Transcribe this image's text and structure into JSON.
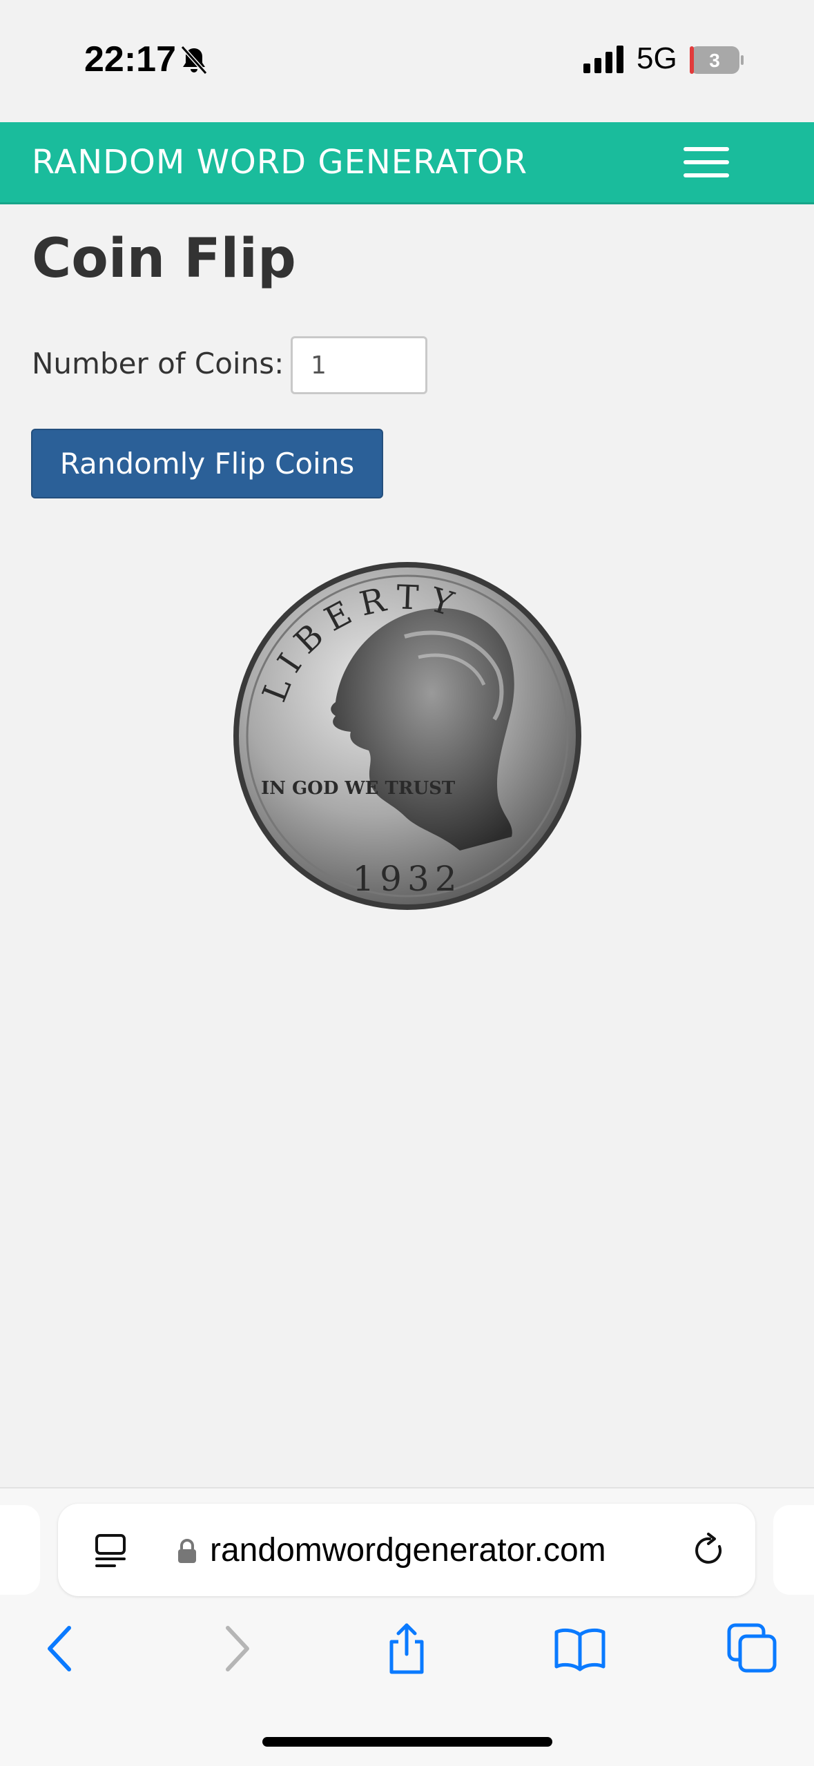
{
  "status_bar": {
    "time": "22:17",
    "network": "5G",
    "battery": "3"
  },
  "header": {
    "brand": "RANDOM WORD GENERATOR",
    "menu_icon": "hamburger-menu-icon"
  },
  "main": {
    "title": "Coin Flip",
    "coins_label": "Number of Coins:",
    "coins_value": "1",
    "flip_button": "Randomly Flip Coins",
    "coin_image": {
      "icon": "quarter-coin-heads",
      "text_top": "LIBERTY",
      "text_left": "IN GOD WE TRUST",
      "text_bottom": "1932"
    }
  },
  "browser": {
    "url": "randomwordgenerator.com",
    "icons": [
      "reader-icon",
      "lock-icon",
      "reload-icon",
      "back-icon",
      "forward-icon",
      "share-icon",
      "bookmarks-icon",
      "tabs-icon"
    ]
  },
  "colors": {
    "header_bg": "#1abc9c",
    "button_bg": "#2b6098",
    "page_bg": "#f2f2f2",
    "ios_blue": "#0a7aff"
  }
}
